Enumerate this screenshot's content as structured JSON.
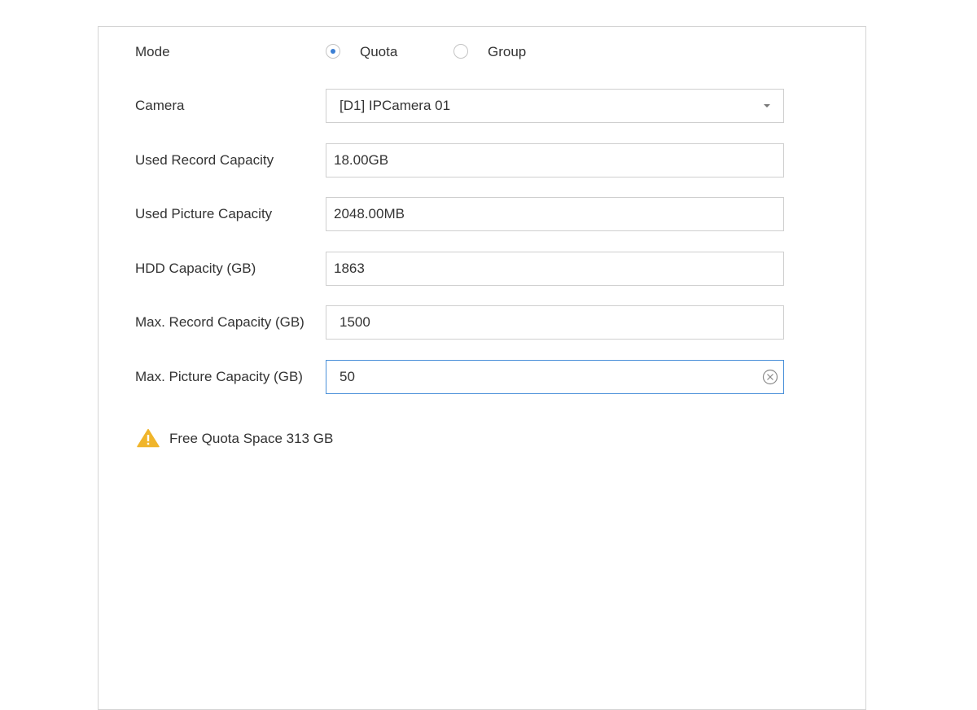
{
  "mode": {
    "label": "Mode",
    "options": [
      {
        "label": "Quota",
        "selected": true
      },
      {
        "label": "Group",
        "selected": false
      }
    ]
  },
  "camera": {
    "label": "Camera",
    "value": "[D1] IPCamera 01"
  },
  "used_record_capacity": {
    "label": "Used Record Capacity",
    "value": "18.00GB"
  },
  "used_picture_capacity": {
    "label": "Used Picture Capacity",
    "value": "2048.00MB"
  },
  "hdd_capacity": {
    "label": "HDD Capacity (GB)",
    "value": "1863"
  },
  "max_record_capacity": {
    "label": "Max. Record Capacity (GB)",
    "value": "1500"
  },
  "max_picture_capacity": {
    "label": "Max. Picture Capacity (GB)",
    "value": "50"
  },
  "notice": {
    "text": "Free Quota Space 313 GB",
    "icon": "warning-icon",
    "icon_color": "#f0b52b"
  },
  "colors": {
    "accent": "#3b7fd4",
    "active_border": "#4a90d9",
    "border": "#cfcfcf"
  }
}
